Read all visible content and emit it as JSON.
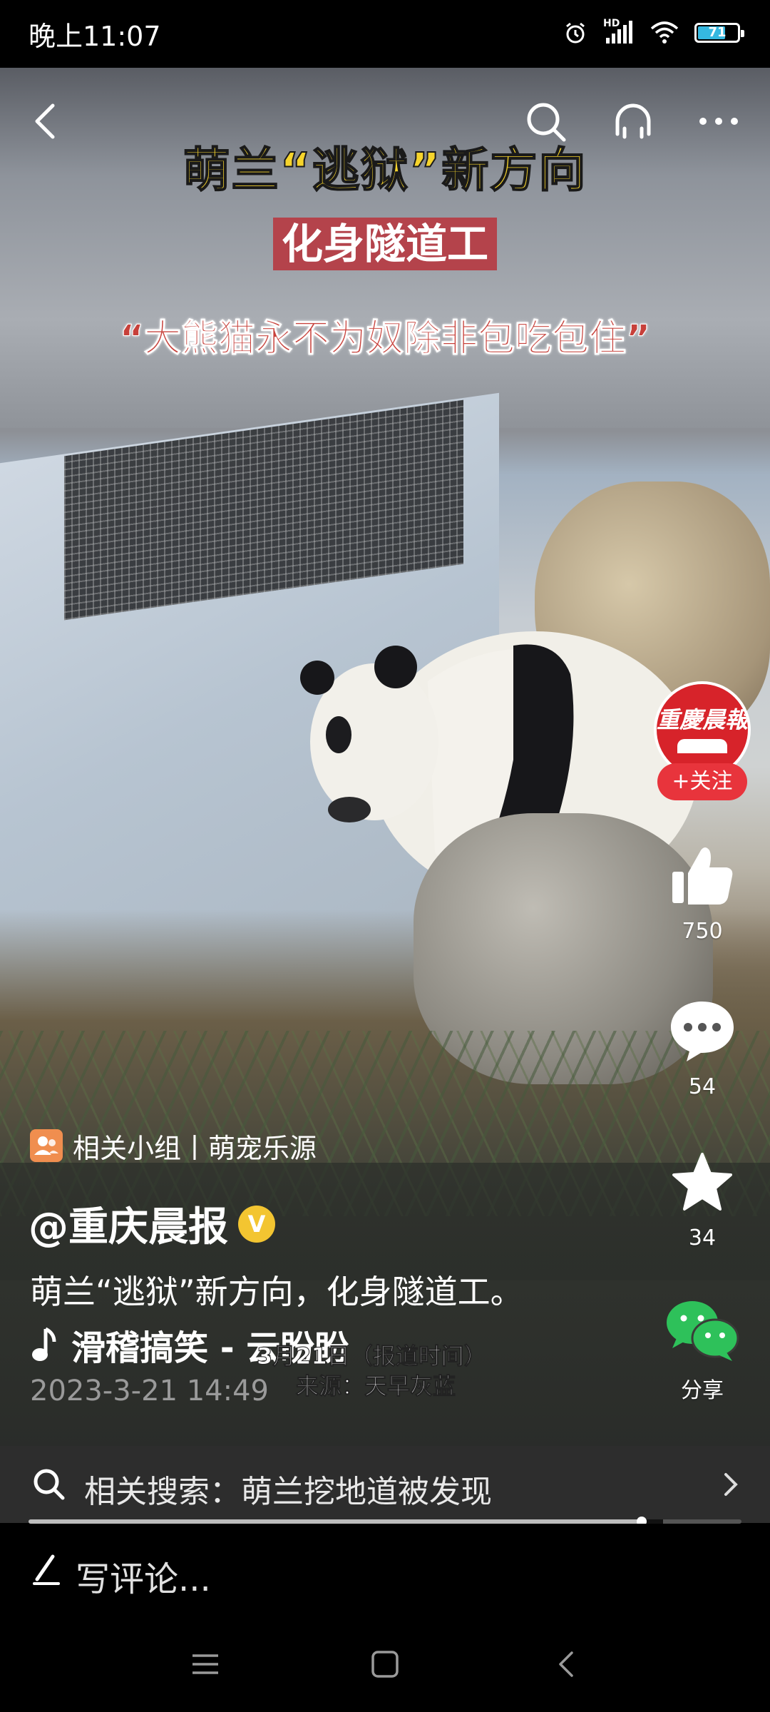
{
  "status_bar": {
    "time": "晚上11:07",
    "network_label": "HD",
    "battery_level": "71",
    "battery_fraction": 0.71
  },
  "video": {
    "title_line1": "萌兰“逃狱”新方向",
    "title_line2": "化身隧道工",
    "title_line3": "“大熊猫永不为奴除非包吃包住”",
    "report_line1": "3月21日（报道时间）",
    "report_line2": "来源：天早灰蓝"
  },
  "publisher": {
    "avatar_text": "重慶晨報",
    "follow_label": "+关注"
  },
  "actions": {
    "likes": "750",
    "comments": "54",
    "favorites": "34",
    "share_label": "分享"
  },
  "post": {
    "group_tag": "相关小组丨萌宠乐源",
    "author": "@重庆晨报",
    "verified_badge": "V",
    "description": "萌兰“逃狱”新方向，化身隧道工。",
    "music": "滑稽搞笑 - 云盼盼",
    "date": "2023-3-21 14:49"
  },
  "related_search": {
    "text": "相关搜索：萌兰挖地道被发现"
  },
  "progress": {
    "value": 0.86
  },
  "comment_bar": {
    "placeholder": "写评论..."
  },
  "colors": {
    "title_yellow": "#f6d42c",
    "title_red_bg": "#b4434b",
    "follow_red": "#e8343c",
    "wechat_green": "#2ec15a",
    "verify_gold": "#f3c531"
  }
}
